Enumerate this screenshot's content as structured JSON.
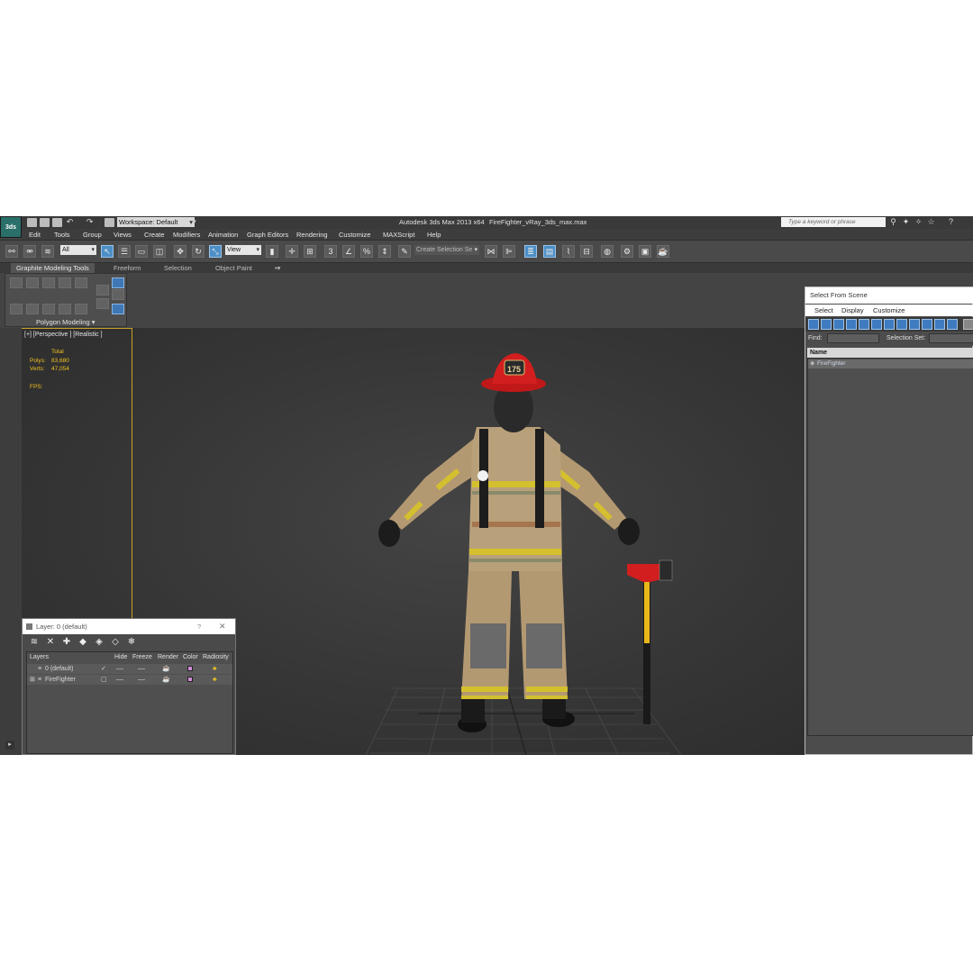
{
  "titlebar": {
    "logo": "3ds",
    "workspace": "Workspace: Default",
    "app_name": "Autodesk 3ds Max  2013 x64",
    "file_name": "FireFighter_vRay_3ds_max.max",
    "search_placeholder": "Type a keyword or phrase"
  },
  "menu": [
    "Edit",
    "Tools",
    "Group",
    "Views",
    "Create",
    "Modifiers",
    "Animation",
    "Graph Editors",
    "Rendering",
    "Customize",
    "MAXScript",
    "Help"
  ],
  "toolbar": {
    "filter_value": "All",
    "view_value": "View",
    "selection_set_placeholder": "Create Selection Se"
  },
  "ribbon": {
    "tabs": [
      "Graphite Modeling Tools",
      "Freeform",
      "Selection",
      "Object Paint"
    ],
    "panel_label": "Polygon Modeling"
  },
  "viewport": {
    "label": "[+] [Perspective ] [Realistic ]",
    "stats": {
      "total_label": "Total",
      "polys_label": "Polys:",
      "polys_value": "83,680",
      "verts_label": "Verts:",
      "verts_value": "47,054",
      "fps_label": "FPS:"
    },
    "helmet_number": "175"
  },
  "layer_dialog": {
    "title": "Layer: 0 (default)",
    "help": "?",
    "close": "✕",
    "columns": [
      "Layers",
      "Hide",
      "Freeze",
      "Render",
      "Color",
      "Radiosity"
    ],
    "rows": [
      {
        "name": "0 (default)",
        "active": "✓",
        "color": "#d08bd6"
      },
      {
        "name": "FireFighter",
        "active": "",
        "color": "#d08bd6"
      }
    ]
  },
  "select_from_scene": {
    "title": "Select From Scene",
    "menu": [
      "Select",
      "Display",
      "Customize"
    ],
    "find_label": "Find:",
    "selection_set_label": "Selection Set:",
    "column_name": "Name",
    "items": [
      "FireFighter"
    ]
  },
  "colors": {
    "viewport_bg": "#383838",
    "accent_blue": "#3f7bc0",
    "stats_yellow": "#f0c020",
    "viewport_border": "#c9a227"
  }
}
